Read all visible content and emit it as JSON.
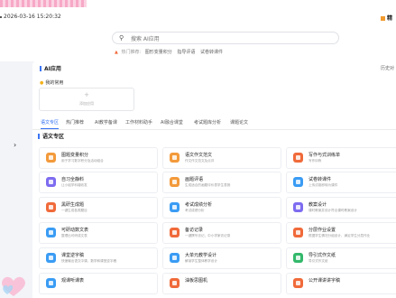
{
  "datebar": {
    "datetime": "2026-03-16 15:20:32",
    "logo_text": "精"
  },
  "search": {
    "placeholder": "搜索 AI应用"
  },
  "hot": {
    "label": "热门推荐:",
    "items": [
      "图形变量积分",
      "指导评语",
      "试卷转课件"
    ]
  },
  "card": {
    "title": "AI应用",
    "history": "历史对"
  },
  "mine": {
    "label": "我的常用",
    "add_text": "添加应用"
  },
  "tabs": [
    "语文专区",
    "热门推荐",
    "AI教学备课",
    "工作材料助手",
    "AI融合课堂",
    "考试题库分析",
    "课题论文"
  ],
  "section_title": "语文专区",
  "tiles": [
    {
      "title": "图题变量积分",
      "desc": "用于学习数字积分及活动组合",
      "color": "#f39a3b"
    },
    {
      "title": "语文作文范文",
      "desc": "作文作文范文及点评",
      "color": "#f39a3b"
    },
    {
      "title": "写作与式训练单",
      "desc": "写作训练",
      "color": "#f06a3a"
    },
    {
      "title": "自习全静料",
      "desc": "让小组学科增收发",
      "color": "#7d6cf0"
    },
    {
      "title": "画题评语",
      "desc": "生成适合的画题评价表学生表扬",
      "color": "#f39a3b"
    },
    {
      "title": "试卷转课件",
      "desc": "上传试卷即转为课件",
      "color": "#3a9cf4"
    },
    {
      "title": "黑研生成题",
      "desc": "一键生成各类题目",
      "color": "#f06a3a"
    },
    {
      "title": "考试成绩分析",
      "desc": "考试成绩分析",
      "color": "#3a9cf4"
    },
    {
      "title": "教案设计",
      "desc": "课时教案并设计符合课时教案设计",
      "color": "#7d6cf0"
    },
    {
      "title": "可研动数文表",
      "desc": "整理出可研成文表",
      "color": "#3a9cf4"
    },
    {
      "title": "备访记录",
      "desc": "一键撰写访记，中小学家访记录",
      "color": "#f06a3a"
    },
    {
      "title": "分层作业设置",
      "desc": "根据学生情况分组设计，满足学生分层作业",
      "color": "#f06a3a"
    },
    {
      "title": "课堂逆字稿",
      "desc": "快速输出语文中课，数学和课堂逆字稿",
      "color": "#3a9cf4"
    },
    {
      "title": "大单元教学设计",
      "desc": "解读学生整体教学设计",
      "color": "#3a9cf4"
    },
    {
      "title": "导引式作文纸",
      "desc": "导引式作文纸",
      "color": "#33b86b"
    },
    {
      "title": "观课听课表",
      "desc": "",
      "color": "#3a9cf4"
    },
    {
      "title": "油板思图机",
      "desc": "",
      "color": "#f06a3a"
    },
    {
      "title": "公开课讲讲字稿",
      "desc": "",
      "color": "#f06a3a"
    }
  ]
}
